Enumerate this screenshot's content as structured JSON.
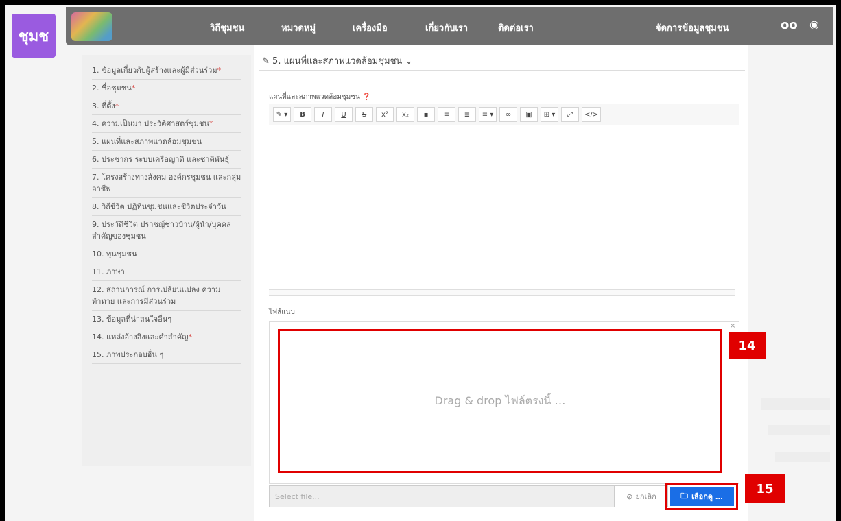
{
  "brand": {
    "badge": "ชุมช"
  },
  "nav": {
    "items": [
      "วิถีชุมชน",
      "หมวดหมู่",
      "เครื่องมือ",
      "เกี่ยวกับเรา",
      "ติดต่อเรา"
    ],
    "manage": "จัดการข้อมูลชุมชน",
    "icons": [
      "glasses-icon",
      "user-icon"
    ],
    "glasses": "oo",
    "user": "◉"
  },
  "sidebar": {
    "items": [
      {
        "label": "1. ข้อมูลเกี่ยวกับผู้สร้างและผู้มีส่วนร่วม",
        "required": true
      },
      {
        "label": "2. ชื่อชุมชน",
        "required": true
      },
      {
        "label": "3. ที่ตั้ง",
        "required": true
      },
      {
        "label": "4. ความเป็นมา ประวัติศาสตร์ชุมชน",
        "required": true
      },
      {
        "label": "5. แผนที่และสภาพแวดล้อมชุมชน",
        "required": false
      },
      {
        "label": "6. ประชากร ระบบเครือญาติ และชาติพันธุ์",
        "required": false
      },
      {
        "label": "7. โครงสร้างทางสังคม องค์กรชุมชน และกลุ่มอาชีพ",
        "required": false
      },
      {
        "label": "8. วิถีชีวิต ปฏิทินชุมชนและชีวิตประจำวัน",
        "required": false
      },
      {
        "label": "9. ประวัติชีวิต ปราชญ์ชาวบ้าน/ผู้นำ/บุคคลสำคัญของชุมชน",
        "required": false
      },
      {
        "label": "10. ทุนชุมชน",
        "required": false
      },
      {
        "label": "11. ภาษา",
        "required": false
      },
      {
        "label": "12. สถานการณ์ การเปลี่ยนแปลง ความท้าทาย และการมีส่วนร่วม",
        "required": false
      },
      {
        "label": "13. ข้อมูลที่น่าสนใจอื่นๆ",
        "required": false
      },
      {
        "label": "14. แหล่งอ้างอิงและคำสำคัญ",
        "required": true
      },
      {
        "label": "15. ภาพประกอบอื่น ๆ",
        "required": false
      }
    ],
    "req_mark": "*"
  },
  "main": {
    "section_title": "5. แผนที่และสภาพแวดล้อมชุมชน",
    "editor_label": "แผนที่และสภาพแวดล้อมชุมชน",
    "toolbar": [
      "✎ ▾",
      "B",
      "I",
      "U",
      "S",
      "x²",
      "x₂",
      "▪",
      "≡",
      "≣",
      "≡ ▾",
      "∞",
      "▣",
      "⊞ ▾",
      "⤢",
      "</>"
    ],
    "attach_label": "ไฟล์แนบ",
    "drop_text": "Drag & drop ไฟล์ตรงนี้ …",
    "file_placeholder": "Select file...",
    "cancel_label": "ยกเลิก",
    "browse_label": "เลือกดู …"
  },
  "callouts": {
    "drop": "14",
    "browse": "15"
  },
  "colors": {
    "accent": "#9a5be0",
    "highlight": "#e00000",
    "primary": "#1a6ee6"
  }
}
